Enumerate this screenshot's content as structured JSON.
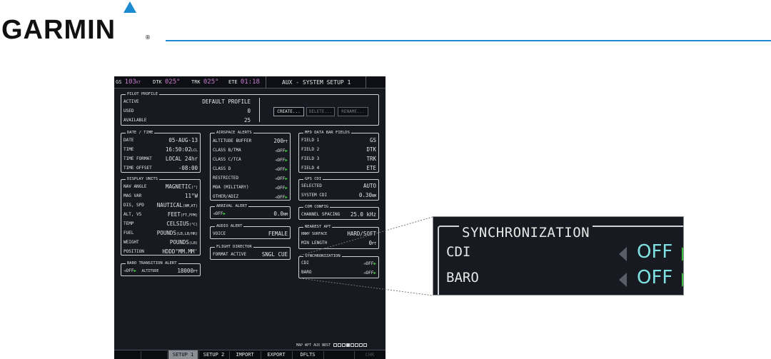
{
  "brand": {
    "name": "GARMIN",
    "reg": "®",
    "accent": "#1b8ad1"
  },
  "topbar": {
    "gs": {
      "label": "GS",
      "value": "103",
      "unit": "KT"
    },
    "dtk": {
      "label": "DTK",
      "value": "025°"
    },
    "trk": {
      "label": "TRK",
      "value": "025°"
    },
    "ete": {
      "label": "ETE",
      "value": "01:18"
    },
    "page_title": "AUX - SYSTEM SETUP 1"
  },
  "pilot_profile": {
    "title": "PILOT PROFILE",
    "active_label": "ACTIVE",
    "active_value": "DEFAULT PROFILE",
    "used_label": "USED",
    "used_value": "0",
    "available_label": "AVAILABLE",
    "available_value": "25",
    "create": "CREATE...",
    "delete": "DELETE...",
    "rename": "RENAME..."
  },
  "date_time": {
    "title": "DATE / TIME",
    "rows": [
      {
        "label": "DATE",
        "value": "05-AUG-13",
        "unit": ""
      },
      {
        "label": "TIME",
        "value": "16:50:02",
        "unit": "LCL"
      },
      {
        "label": "TIME FORMAT",
        "value": "LOCAL 24hr",
        "unit": ""
      },
      {
        "label": "TIME OFFSET",
        "value": "-08:00",
        "unit": ""
      }
    ]
  },
  "display_units": {
    "title": "DISPLAY UNITS",
    "rows": [
      {
        "label": "NAV ANGLE",
        "value": "MAGNETIC",
        "unit": "(°)"
      },
      {
        "label": "MAG VAR",
        "value": "11°W",
        "unit": ""
      },
      {
        "label": "DIS, SPD",
        "value": "NAUTICAL",
        "unit": "(NM,KT)"
      },
      {
        "label": "ALT, VS",
        "value": "FEET",
        "unit": "(FT,FPM)"
      },
      {
        "label": "TEMP",
        "value": "CELSIUS",
        "unit": "(°C)"
      },
      {
        "label": "FUEL",
        "value": "POUNDS",
        "unit": "(LB,LB/HR)"
      },
      {
        "label": "WEIGHT",
        "value": "POUNDS",
        "unit": "(LB)"
      },
      {
        "label": "POSITION",
        "value": "HDDD°MM.MM'",
        "unit": ""
      }
    ]
  },
  "baro_transition": {
    "title": "BARO TRANSITION ALERT",
    "state": "OFF",
    "alt_label": "ALTITUDE",
    "alt_value": "18000",
    "alt_unit": "FT"
  },
  "airspace_alerts": {
    "title": "AIRSPACE ALERTS",
    "buffer_label": "ALTITUDE BUFFER",
    "buffer_value": "200",
    "buffer_unit": "FT",
    "rows": [
      {
        "label": "CLASS B/TMA",
        "value": "OFF"
      },
      {
        "label": "CLASS C/TCA",
        "value": "OFF"
      },
      {
        "label": "CLASS D",
        "value": "OFF"
      },
      {
        "label": "RESTRICTED",
        "value": "OFF"
      },
      {
        "label": "MOA (MILITARY)",
        "value": "OFF"
      },
      {
        "label": "OTHER/ADIZ",
        "value": "OFF"
      }
    ]
  },
  "arrival_alert": {
    "title": "ARRIVAL ALERT",
    "state": "OFF",
    "value": "0.0",
    "unit": "NM"
  },
  "audio_alert": {
    "title": "AUDIO ALERT",
    "voice_label": "VOICE",
    "voice_value": "FEMALE"
  },
  "flight_director": {
    "title": "FLIGHT DIRECTOR",
    "label": "FORMAT ACTIVE",
    "value": "SNGL CUE"
  },
  "mfd_data_bar": {
    "title": "MFD DATA BAR FIELDS",
    "rows": [
      {
        "label": "FIELD 1",
        "value": "GS"
      },
      {
        "label": "FIELD 2",
        "value": "DTK"
      },
      {
        "label": "FIELD 3",
        "value": "TRK"
      },
      {
        "label": "FIELD 4",
        "value": "ETE"
      }
    ]
  },
  "gps_cdi": {
    "title": "GPS CDI",
    "selected_label": "SELECTED",
    "selected_value": "AUTO",
    "system_label": "SYSTEM CDI",
    "system_value": "0.30",
    "system_unit": "NM"
  },
  "com_config": {
    "title": "COM CONFIG",
    "label": "CHANNEL SPACING",
    "value": "25.0 kHz"
  },
  "nearest_apt": {
    "title": "NEAREST APT",
    "surface_label": "RNWY SURFACE",
    "surface_value": "HARD/SOFT",
    "length_label": "MIN LENGTH",
    "length_value": "0",
    "length_unit": "FT"
  },
  "synchronization": {
    "title": "SYNCHRONIZATION",
    "cdi_label": "CDI",
    "cdi_value": "OFF",
    "baro_label": "BARO",
    "baro_value": "OFF"
  },
  "map_strip": {
    "text": "MAP WPT AUX NRST"
  },
  "softkeys": [
    "SETUP 1",
    "SETUP 2",
    "IMPORT",
    "EXPORT",
    "DFLTS",
    "CHK"
  ],
  "colors": {
    "screen_bg": "#171a21",
    "value_cyan": "#7fe0e0",
    "arrow_green": "#3fbf3f",
    "topbar_magenta": "#c87bd0"
  }
}
